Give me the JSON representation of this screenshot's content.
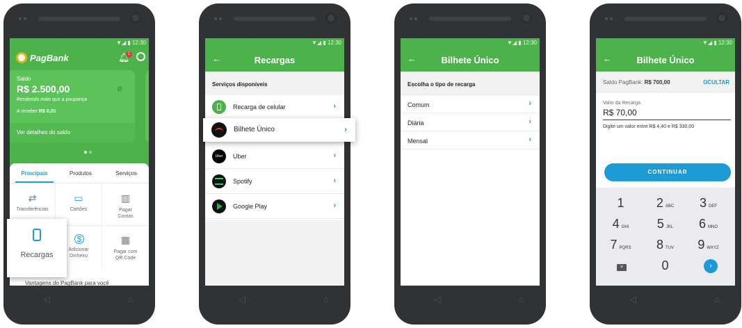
{
  "status": {
    "time": "12:30",
    "signal": "▼◢ ▮"
  },
  "screen1": {
    "brand": "PagBank",
    "notif_badge": "1",
    "balance_label": "Saldo",
    "balance_value": "R$ 2.500,00",
    "yield_text": "Rendendo mais que a poupança",
    "receive_label": "A receber",
    "receive_value": "R$ 0,00",
    "details_link": "Ver detalhes do saldo",
    "tabs": [
      {
        "label": "Principais"
      },
      {
        "label": "Produtos"
      },
      {
        "label": "Serviços"
      }
    ],
    "grid": [
      {
        "label": "Transferências",
        "icon": "⇄"
      },
      {
        "label": "Cartões",
        "icon": "▭"
      },
      {
        "label": "Pagar\nContas",
        "icon": "▥"
      },
      {
        "label": "Recargas",
        "icon": "▯"
      },
      {
        "label": "Adicionar\nDinheiro",
        "icon": "$"
      },
      {
        "label": "Pagar com\nQR Code",
        "icon": "▦"
      }
    ],
    "footer_text": "Vantagens do PagBank para você"
  },
  "screen2": {
    "title": "Recargas",
    "section": "Serviços disponíveis",
    "items": [
      {
        "label": "Recarga de celular",
        "color": "#4bb34a"
      },
      {
        "label": "Bilhete Único",
        "color": "#111111"
      },
      {
        "label": "Uber",
        "color": "#000000",
        "icon_text": "Uber"
      },
      {
        "label": "Spotify",
        "color": "#111111"
      },
      {
        "label": "Google Play",
        "color": "#111111"
      }
    ]
  },
  "screen3": {
    "title": "Bilhete Único",
    "section": "Escolha o tipo de recarga",
    "items": [
      {
        "label": "Comum"
      },
      {
        "label": "Diária"
      },
      {
        "label": "Mensal"
      }
    ]
  },
  "screen4": {
    "title": "Bilhete Único",
    "balance_label": "Saldo PagBank:",
    "balance_value": "R$ 700,00",
    "hide_label": "OCULTAR",
    "field_label": "Valor da Recarga",
    "field_value": "R$ 70,00",
    "hint": "Digite um valor entre R$ 4,40 e R$ 330,00",
    "continue_label": "CONTINUAR",
    "keys": [
      {
        "num": "1",
        "letters": ""
      },
      {
        "num": "2",
        "letters": "ABC"
      },
      {
        "num": "3",
        "letters": "DEF"
      },
      {
        "num": "4",
        "letters": "GHI"
      },
      {
        "num": "5",
        "letters": "JKL"
      },
      {
        "num": "6",
        "letters": "MNO"
      },
      {
        "num": "7",
        "letters": "PQRS"
      },
      {
        "num": "8",
        "letters": "TUV"
      },
      {
        "num": "9",
        "letters": "WXYZ"
      }
    ],
    "zero_key": "0"
  },
  "colors": {
    "brand_green": "#4bb34a",
    "accent_blue": "#1e9ad6",
    "bezel": "#2f3336"
  },
  "icons": {
    "back": "←",
    "chevron": "›",
    "bell": "bell-icon",
    "profile": "profile-icon",
    "eye_off": "eye-off-icon",
    "backspace": "backspace-icon",
    "nav_back": "◁",
    "nav_home": "⌂"
  }
}
